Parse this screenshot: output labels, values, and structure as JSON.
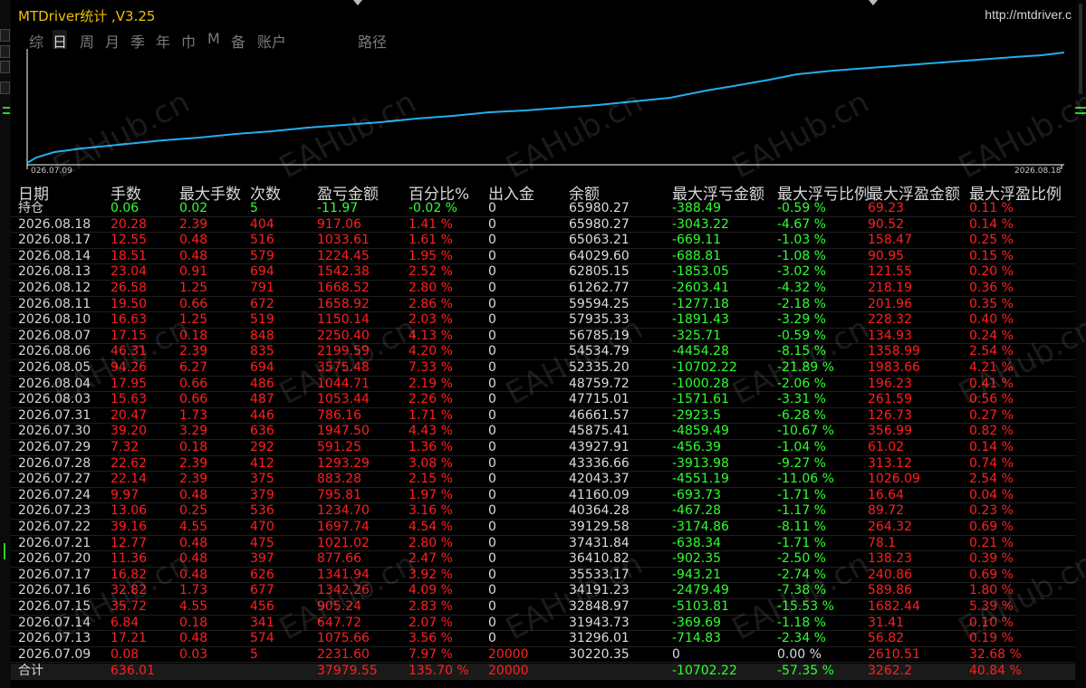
{
  "window": {
    "title": "MTDriver统计 ,V3.25",
    "url": "http://mtdriver.c"
  },
  "tabs": [
    "综",
    "日",
    "周",
    "月",
    "季",
    "年",
    "巾",
    "M",
    "备",
    "账户",
    "路径"
  ],
  "active_tab": "日",
  "chart": {
    "start_label": "026.07.09",
    "end_label": "2026.08.18",
    "line_color": "#22aef0"
  },
  "columns": [
    "日期",
    "手数",
    "最大手数",
    "次数",
    "盈亏金额",
    "百分比%",
    "出入金",
    "余额",
    "最大浮亏金额",
    "最大浮亏比例",
    "最大浮盈金额",
    "最大浮盈比例"
  ],
  "position_row": {
    "label": "持仓",
    "lots": "0.06",
    "max_lots": "0.02",
    "count": "5",
    "pnl": "-11.97",
    "pct": "-0.02 %",
    "inout": "0",
    "balance": "65980.27",
    "max_dd": "-388.49",
    "max_dd_pct": "-0.59 %",
    "max_fp": "69.23",
    "max_fp_pct": "0.11 %"
  },
  "rows": [
    {
      "date": "2026.08.18",
      "lots": "20.28",
      "max_lots": "2.39",
      "count": "404",
      "pnl": "917.06",
      "pct": "1.41 %",
      "inout": "0",
      "balance": "65980.27",
      "max_dd": "-3043.22",
      "max_dd_pct": "-4.67 %",
      "max_fp": "90.52",
      "max_fp_pct": "0.14 %"
    },
    {
      "date": "2026.08.17",
      "lots": "12.55",
      "max_lots": "0.48",
      "count": "516",
      "pnl": "1033.61",
      "pct": "1.61 %",
      "inout": "0",
      "balance": "65063.21",
      "max_dd": "-669.11",
      "max_dd_pct": "-1.03 %",
      "max_fp": "158.47",
      "max_fp_pct": "0.25 %"
    },
    {
      "date": "2026.08.14",
      "lots": "18.51",
      "max_lots": "0.48",
      "count": "579",
      "pnl": "1224.45",
      "pct": "1.95 %",
      "inout": "0",
      "balance": "64029.60",
      "max_dd": "-688.81",
      "max_dd_pct": "-1.08 %",
      "max_fp": "90.95",
      "max_fp_pct": "0.15 %"
    },
    {
      "date": "2026.08.13",
      "lots": "23.04",
      "max_lots": "0.91",
      "count": "694",
      "pnl": "1542.38",
      "pct": "2.52 %",
      "inout": "0",
      "balance": "62805.15",
      "max_dd": "-1853.05",
      "max_dd_pct": "-3.02 %",
      "max_fp": "121.55",
      "max_fp_pct": "0.20 %"
    },
    {
      "date": "2026.08.12",
      "lots": "26.58",
      "max_lots": "1.25",
      "count": "791",
      "pnl": "1668.52",
      "pct": "2.80 %",
      "inout": "0",
      "balance": "61262.77",
      "max_dd": "-2603.41",
      "max_dd_pct": "-4.32 %",
      "max_fp": "218.19",
      "max_fp_pct": "0.36 %"
    },
    {
      "date": "2026.08.11",
      "lots": "19.50",
      "max_lots": "0.66",
      "count": "672",
      "pnl": "1658.92",
      "pct": "2.86 %",
      "inout": "0",
      "balance": "59594.25",
      "max_dd": "-1277.18",
      "max_dd_pct": "-2.18 %",
      "max_fp": "201.96",
      "max_fp_pct": "0.35 %"
    },
    {
      "date": "2026.08.10",
      "lots": "16.63",
      "max_lots": "1.25",
      "count": "519",
      "pnl": "1150.14",
      "pct": "2.03 %",
      "inout": "0",
      "balance": "57935.33",
      "max_dd": "-1891.43",
      "max_dd_pct": "-3.29 %",
      "max_fp": "228.32",
      "max_fp_pct": "0.40 %"
    },
    {
      "date": "2026.08.07",
      "lots": "17.15",
      "max_lots": "0.18",
      "count": "848",
      "pnl": "2250.40",
      "pct": "4.13 %",
      "inout": "0",
      "balance": "56785.19",
      "max_dd": "-325.71",
      "max_dd_pct": "-0.59 %",
      "max_fp": "134.93",
      "max_fp_pct": "0.24 %"
    },
    {
      "date": "2026.08.06",
      "lots": "46.31",
      "max_lots": "2.39",
      "count": "835",
      "pnl": "2199.59",
      "pct": "4.20 %",
      "inout": "0",
      "balance": "54534.79",
      "max_dd": "-4454.28",
      "max_dd_pct": "-8.15 %",
      "max_fp": "1358.99",
      "max_fp_pct": "2.54 %"
    },
    {
      "date": "2026.08.05",
      "lots": "94.26",
      "max_lots": "6.27",
      "count": "694",
      "pnl": "3575.48",
      "pct": "7.33 %",
      "inout": "0",
      "balance": "52335.20",
      "max_dd": "-10702.22",
      "max_dd_pct": "-21.89 %",
      "max_fp": "1983.66",
      "max_fp_pct": "4.21 %"
    },
    {
      "date": "2026.08.04",
      "lots": "17.95",
      "max_lots": "0.66",
      "count": "486",
      "pnl": "1044.71",
      "pct": "2.19 %",
      "inout": "0",
      "balance": "48759.72",
      "max_dd": "-1000.28",
      "max_dd_pct": "-2.06 %",
      "max_fp": "196.23",
      "max_fp_pct": "0.41 %"
    },
    {
      "date": "2026.08.03",
      "lots": "15.63",
      "max_lots": "0.66",
      "count": "487",
      "pnl": "1053.44",
      "pct": "2.26 %",
      "inout": "0",
      "balance": "47715.01",
      "max_dd": "-1571.61",
      "max_dd_pct": "-3.31 %",
      "max_fp": "261.59",
      "max_fp_pct": "0.56 %"
    },
    {
      "date": "2026.07.31",
      "lots": "20.47",
      "max_lots": "1.73",
      "count": "446",
      "pnl": "786.16",
      "pct": "1.71 %",
      "inout": "0",
      "balance": "46661.57",
      "max_dd": "-2923.5",
      "max_dd_pct": "-6.28 %",
      "max_fp": "126.73",
      "max_fp_pct": "0.27 %"
    },
    {
      "date": "2026.07.30",
      "lots": "39.20",
      "max_lots": "3.29",
      "count": "636",
      "pnl": "1947.50",
      "pct": "4.43 %",
      "inout": "0",
      "balance": "45875.41",
      "max_dd": "-4859.49",
      "max_dd_pct": "-10.67 %",
      "max_fp": "356.99",
      "max_fp_pct": "0.82 %"
    },
    {
      "date": "2026.07.29",
      "lots": "7.32",
      "max_lots": "0.18",
      "count": "292",
      "pnl": "591.25",
      "pct": "1.36 %",
      "inout": "0",
      "balance": "43927.91",
      "max_dd": "-456.39",
      "max_dd_pct": "-1.04 %",
      "max_fp": "61.02",
      "max_fp_pct": "0.14 %"
    },
    {
      "date": "2026.07.28",
      "lots": "22.62",
      "max_lots": "2.39",
      "count": "412",
      "pnl": "1293.29",
      "pct": "3.08 %",
      "inout": "0",
      "balance": "43336.66",
      "max_dd": "-3913.98",
      "max_dd_pct": "-9.27 %",
      "max_fp": "313.12",
      "max_fp_pct": "0.74 %"
    },
    {
      "date": "2026.07.27",
      "lots": "22.14",
      "max_lots": "2.39",
      "count": "375",
      "pnl": "883.28",
      "pct": "2.15 %",
      "inout": "0",
      "balance": "42043.37",
      "max_dd": "-4551.19",
      "max_dd_pct": "-11.06 %",
      "max_fp": "1026.09",
      "max_fp_pct": "2.54 %"
    },
    {
      "date": "2026.07.24",
      "lots": "9.97",
      "max_lots": "0.48",
      "count": "379",
      "pnl": "795.81",
      "pct": "1.97 %",
      "inout": "0",
      "balance": "41160.09",
      "max_dd": "-693.73",
      "max_dd_pct": "-1.71 %",
      "max_fp": "16.64",
      "max_fp_pct": "0.04 %"
    },
    {
      "date": "2026.07.23",
      "lots": "13.06",
      "max_lots": "0.25",
      "count": "536",
      "pnl": "1234.70",
      "pct": "3.16 %",
      "inout": "0",
      "balance": "40364.28",
      "max_dd": "-467.28",
      "max_dd_pct": "-1.17 %",
      "max_fp": "89.72",
      "max_fp_pct": "0.23 %"
    },
    {
      "date": "2026.07.22",
      "lots": "39.16",
      "max_lots": "4.55",
      "count": "470",
      "pnl": "1697.74",
      "pct": "4.54 %",
      "inout": "0",
      "balance": "39129.58",
      "max_dd": "-3174.86",
      "max_dd_pct": "-8.11 %",
      "max_fp": "264.32",
      "max_fp_pct": "0.69 %"
    },
    {
      "date": "2026.07.21",
      "lots": "12.77",
      "max_lots": "0.48",
      "count": "475",
      "pnl": "1021.02",
      "pct": "2.80 %",
      "inout": "0",
      "balance": "37431.84",
      "max_dd": "-638.34",
      "max_dd_pct": "-1.71 %",
      "max_fp": "78.1",
      "max_fp_pct": "0.21 %"
    },
    {
      "date": "2026.07.20",
      "lots": "11.36",
      "max_lots": "0.48",
      "count": "397",
      "pnl": "877.66",
      "pct": "2.47 %",
      "inout": "0",
      "balance": "36410.82",
      "max_dd": "-902.35",
      "max_dd_pct": "-2.50 %",
      "max_fp": "138.23",
      "max_fp_pct": "0.39 %"
    },
    {
      "date": "2026.07.17",
      "lots": "16.82",
      "max_lots": "0.48",
      "count": "626",
      "pnl": "1341.94",
      "pct": "3.92 %",
      "inout": "0",
      "balance": "35533.17",
      "max_dd": "-943.21",
      "max_dd_pct": "-2.74 %",
      "max_fp": "240.86",
      "max_fp_pct": "0.69 %"
    },
    {
      "date": "2026.07.16",
      "lots": "32.82",
      "max_lots": "1.73",
      "count": "677",
      "pnl": "1342.26",
      "pct": "4.09 %",
      "inout": "0",
      "balance": "34191.23",
      "max_dd": "-2479.49",
      "max_dd_pct": "-7.38 %",
      "max_fp": "589.86",
      "max_fp_pct": "1.80 %"
    },
    {
      "date": "2026.07.15",
      "lots": "35.72",
      "max_lots": "4.55",
      "count": "456",
      "pnl": "905.24",
      "pct": "2.83 %",
      "inout": "0",
      "balance": "32848.97",
      "max_dd": "-5103.81",
      "max_dd_pct": "-15.53 %",
      "max_fp": "1682.44",
      "max_fp_pct": "5.39 %"
    },
    {
      "date": "2026.07.14",
      "lots": "6.84",
      "max_lots": "0.18",
      "count": "341",
      "pnl": "647.72",
      "pct": "2.07 %",
      "inout": "0",
      "balance": "31943.73",
      "max_dd": "-369.69",
      "max_dd_pct": "-1.18 %",
      "max_fp": "31.41",
      "max_fp_pct": "0.10 %"
    },
    {
      "date": "2026.07.13",
      "lots": "17.21",
      "max_lots": "0.48",
      "count": "574",
      "pnl": "1075.66",
      "pct": "3.56 %",
      "inout": "0",
      "balance": "31296.01",
      "max_dd": "-714.83",
      "max_dd_pct": "-2.34 %",
      "max_fp": "56.82",
      "max_fp_pct": "0.19 %"
    },
    {
      "date": "2026.07.09",
      "lots": "0.08",
      "max_lots": "0.03",
      "count": "5",
      "pnl": "2231.60",
      "pct": "7.97 %",
      "inout": "20000",
      "balance": "30220.35",
      "max_dd": "0",
      "max_dd_pct": "0.00 %",
      "max_fp": "2610.51",
      "max_fp_pct": "32.68 %"
    }
  ],
  "total_row": {
    "label": "合计",
    "lots": "636.01",
    "pnl": "37979.55",
    "pct": "135.70 %",
    "inout": "20000",
    "max_dd": "-10702.22",
    "max_dd_pct": "-57.35 %",
    "max_fp": "3262.2",
    "max_fp_pct": "40.84 %"
  },
  "watermark": "EAHub.cn",
  "colors": {
    "title": "#f0c000",
    "profit": "#ff2020",
    "loss": "#30ff30",
    "line": "#22aef0"
  }
}
